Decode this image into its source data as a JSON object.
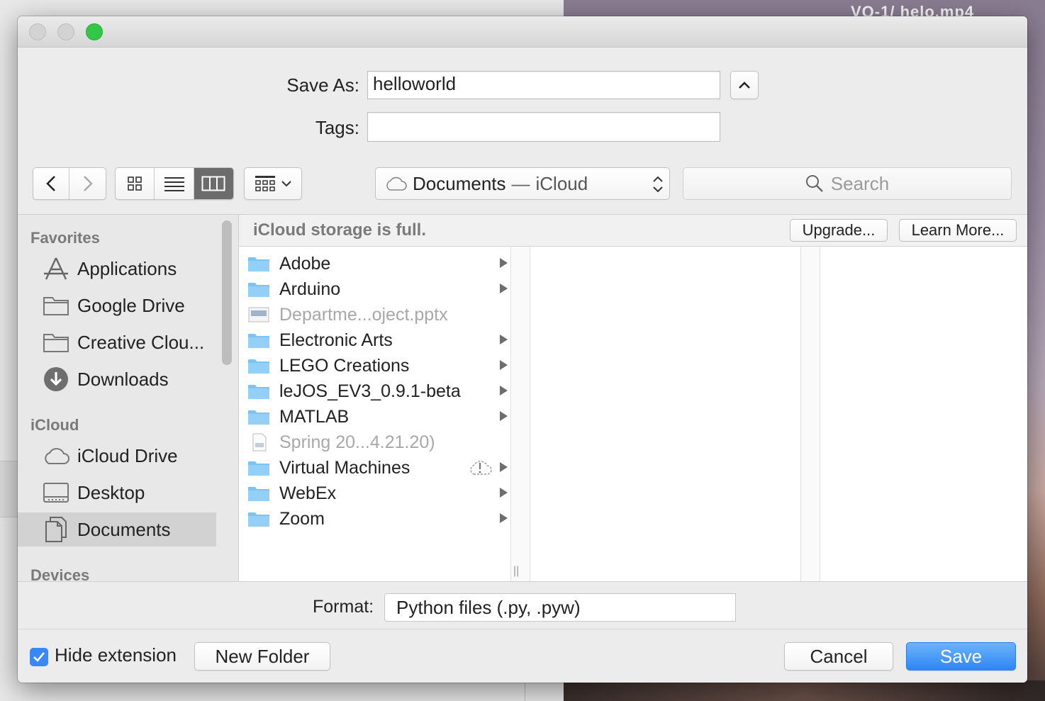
{
  "background": {
    "window_title": "VQ-1/ helo.mp4"
  },
  "dialog": {
    "save_as_label": "Save As:",
    "save_as_value": "helloworld",
    "tags_label": "Tags:",
    "tags_value": "",
    "location": {
      "name": "Documents",
      "separator": "—",
      "service": "iCloud"
    },
    "search_placeholder": "Search",
    "view_modes": [
      "icon-view",
      "list-view",
      "column-view"
    ],
    "active_view": "column-view"
  },
  "sidebar": {
    "favorites_heading": "Favorites",
    "favorites": [
      {
        "label": "Applications",
        "icon": "applications-icon"
      },
      {
        "label": "Google Drive",
        "icon": "folder-icon"
      },
      {
        "label": "Creative Clou...",
        "icon": "folder-icon"
      },
      {
        "label": "Downloads",
        "icon": "downloads-icon"
      }
    ],
    "icloud_heading": "iCloud",
    "icloud": [
      {
        "label": "iCloud Drive",
        "icon": "cloud-icon"
      },
      {
        "label": "Desktop",
        "icon": "desktop-icon"
      },
      {
        "label": "Documents",
        "icon": "documents-icon",
        "selected": true
      }
    ],
    "devices_heading": "Devices"
  },
  "banner": {
    "message": "iCloud storage is full.",
    "upgrade_label": "Upgrade...",
    "learn_more_label": "Learn More..."
  },
  "files": [
    {
      "name": "Adobe",
      "type": "folder",
      "dimmed": false
    },
    {
      "name": "Arduino",
      "type": "folder",
      "dimmed": false
    },
    {
      "name": "Departme...oject.pptx",
      "type": "pptx",
      "dimmed": true
    },
    {
      "name": "Electronic Arts",
      "type": "folder",
      "dimmed": false
    },
    {
      "name": "LEGO Creations",
      "type": "folder",
      "dimmed": false
    },
    {
      "name": "leJOS_EV3_0.9.1-beta",
      "type": "folder",
      "dimmed": false
    },
    {
      "name": "MATLAB",
      "type": "folder",
      "dimmed": false
    },
    {
      "name": "Spring 20...4.21.20)",
      "type": "document",
      "dimmed": true
    },
    {
      "name": "Virtual Machines",
      "type": "folder",
      "dimmed": false,
      "warning": true
    },
    {
      "name": "WebEx",
      "type": "folder",
      "dimmed": false
    },
    {
      "name": "Zoom",
      "type": "folder",
      "dimmed": false
    }
  ],
  "format": {
    "label": "Format:",
    "value": "Python files (.py, .pyw)"
  },
  "bottom": {
    "hide_extension_label": "Hide extension",
    "hide_extension_checked": true,
    "new_folder_label": "New Folder",
    "cancel_label": "Cancel",
    "save_label": "Save"
  },
  "colors": {
    "accent": "#3a87f7",
    "folder": "#7dc2f5"
  }
}
